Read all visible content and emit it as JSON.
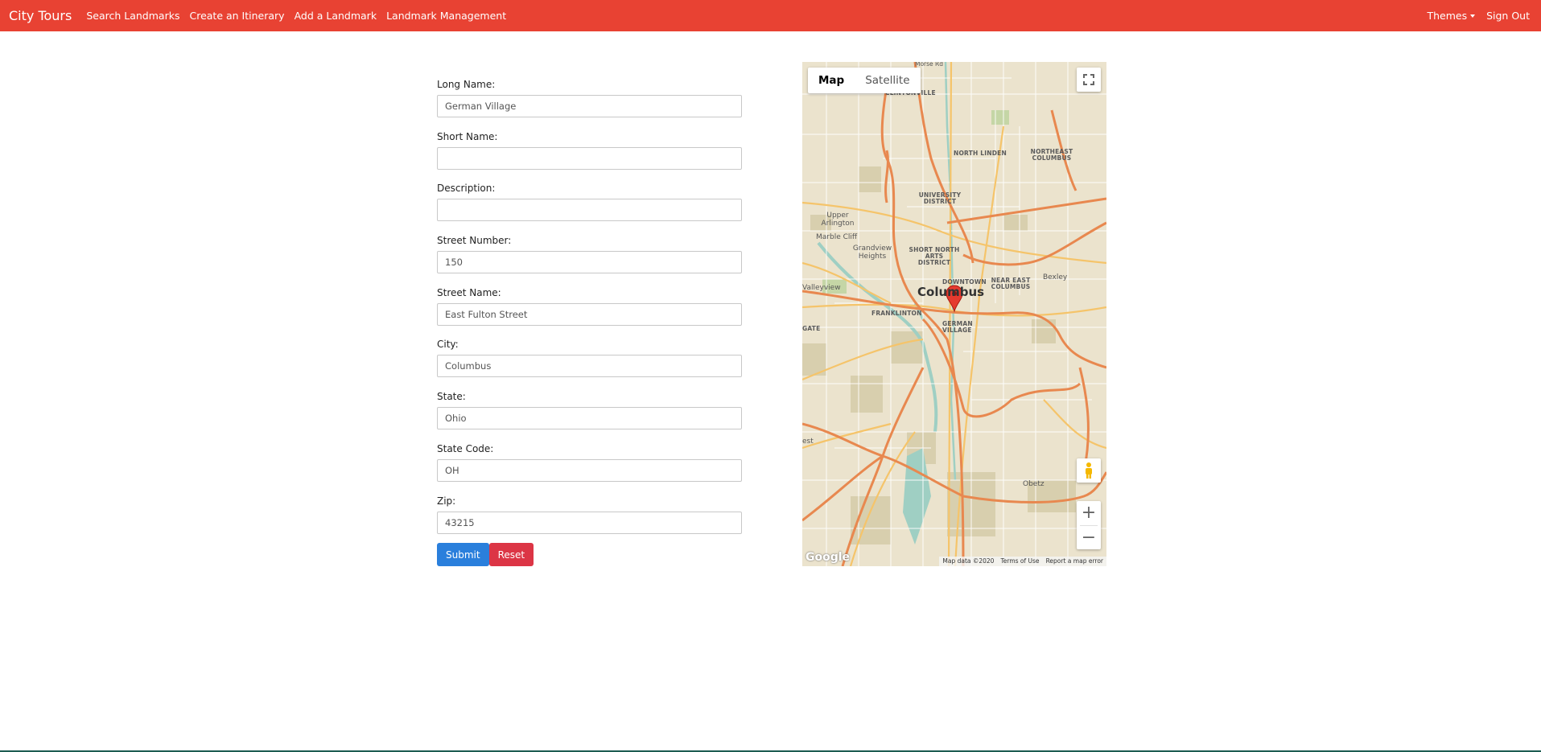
{
  "navbar": {
    "brand": "City Tours",
    "links": [
      "Search Landmarks",
      "Create an Itinerary",
      "Add a Landmark",
      "Landmark Management"
    ],
    "themes": "Themes",
    "sign_out": "Sign Out"
  },
  "form": {
    "fields": [
      {
        "label": "Long Name:",
        "value": "German Village"
      },
      {
        "label": "Short Name:",
        "value": ""
      },
      {
        "label": "Description:",
        "value": ""
      },
      {
        "label": "Street Number:",
        "value": "150"
      },
      {
        "label": "Street Name:",
        "value": "East Fulton Street"
      },
      {
        "label": "City:",
        "value": "Columbus"
      },
      {
        "label": "State:",
        "value": "Ohio"
      },
      {
        "label": "State Code:",
        "value": "OH"
      },
      {
        "label": "Zip:",
        "value": "43215"
      }
    ],
    "submit_label": "Submit",
    "reset_label": "Reset"
  },
  "map": {
    "type_buttons": [
      "Map",
      "Satellite"
    ],
    "logo": "Google",
    "footer": [
      "Map data ©2020",
      "Terms of Use",
      "Report a map error"
    ],
    "labels": {
      "morse_rd": "Morse Rd",
      "clintonville": "CLINTONVILLE",
      "north_linden": "NORTH LINDEN",
      "northeast_columbus": "NORTHEAST COLUMBUS",
      "university_district": "UNIVERSITY DISTRICT",
      "upper_arlington": "Upper Arlington",
      "marble_cliff": "Marble Cliff",
      "grandview_heights": "Grandview Heights",
      "short_north": "SHORT NORTH ARTS DISTRICT",
      "downtown": "DOWNTOWN",
      "near_east": "NEAR EAST COLUMBUS",
      "bexley": "Bexley",
      "valleyview": "Valleyview",
      "columbus": "Columbus",
      "franklinton": "FRANKLINTON",
      "german_village": "GERMAN VILLAGE",
      "gate": "GATE",
      "est": "est",
      "obetz": "Obetz"
    },
    "colors": {
      "highway": "#e8884f",
      "arterial": "#f5c46a",
      "land": "#ebe3cd",
      "park": "#c9c29c",
      "water": "#9fcfc3",
      "marker": "#e53a2f"
    }
  },
  "colors": {
    "navbar": "#e84233",
    "submit": "#2a7fdc",
    "reset": "#dc3545"
  },
  "icons": {
    "fullscreen": "fullscreen-icon",
    "pegman": "pegman-icon",
    "marker": "map-marker-icon"
  }
}
